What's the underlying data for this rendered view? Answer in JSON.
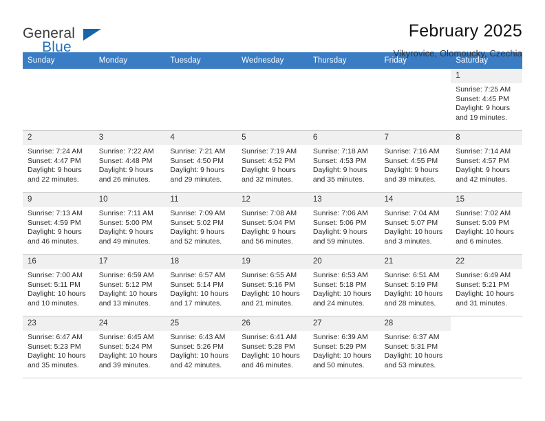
{
  "brand": {
    "name_part1": "General",
    "name_part2": "Blue",
    "triangle_icon": "brand-triangle-icon"
  },
  "header": {
    "title": "February 2025",
    "location": "Vikyrovice, Olomoucky, Czechia"
  },
  "colors": {
    "header_row_bg": "#3B7DC4",
    "header_row_text": "#FFFFFF",
    "brand_blue": "#2071B8",
    "cell_shade": "#F0F0F0",
    "empty_cell": "#F4F4F4",
    "grid_line": "#C9C9C9"
  },
  "weekdays": [
    "Sunday",
    "Monday",
    "Tuesday",
    "Wednesday",
    "Thursday",
    "Friday",
    "Saturday"
  ],
  "weeks": [
    [
      {
        "day": "",
        "empty": true
      },
      {
        "day": "",
        "empty": true
      },
      {
        "day": "",
        "empty": true
      },
      {
        "day": "",
        "empty": true
      },
      {
        "day": "",
        "empty": true
      },
      {
        "day": "",
        "empty": true
      },
      {
        "day": "1",
        "sunrise": "Sunrise: 7:25 AM",
        "sunset": "Sunset: 4:45 PM",
        "daylight1": "Daylight: 9 hours",
        "daylight2": "and 19 minutes."
      }
    ],
    [
      {
        "day": "2",
        "sunrise": "Sunrise: 7:24 AM",
        "sunset": "Sunset: 4:47 PM",
        "daylight1": "Daylight: 9 hours",
        "daylight2": "and 22 minutes."
      },
      {
        "day": "3",
        "sunrise": "Sunrise: 7:22 AM",
        "sunset": "Sunset: 4:48 PM",
        "daylight1": "Daylight: 9 hours",
        "daylight2": "and 26 minutes."
      },
      {
        "day": "4",
        "sunrise": "Sunrise: 7:21 AM",
        "sunset": "Sunset: 4:50 PM",
        "daylight1": "Daylight: 9 hours",
        "daylight2": "and 29 minutes."
      },
      {
        "day": "5",
        "sunrise": "Sunrise: 7:19 AM",
        "sunset": "Sunset: 4:52 PM",
        "daylight1": "Daylight: 9 hours",
        "daylight2": "and 32 minutes."
      },
      {
        "day": "6",
        "sunrise": "Sunrise: 7:18 AM",
        "sunset": "Sunset: 4:53 PM",
        "daylight1": "Daylight: 9 hours",
        "daylight2": "and 35 minutes."
      },
      {
        "day": "7",
        "sunrise": "Sunrise: 7:16 AM",
        "sunset": "Sunset: 4:55 PM",
        "daylight1": "Daylight: 9 hours",
        "daylight2": "and 39 minutes."
      },
      {
        "day": "8",
        "sunrise": "Sunrise: 7:14 AM",
        "sunset": "Sunset: 4:57 PM",
        "daylight1": "Daylight: 9 hours",
        "daylight2": "and 42 minutes."
      }
    ],
    [
      {
        "day": "9",
        "sunrise": "Sunrise: 7:13 AM",
        "sunset": "Sunset: 4:59 PM",
        "daylight1": "Daylight: 9 hours",
        "daylight2": "and 46 minutes."
      },
      {
        "day": "10",
        "sunrise": "Sunrise: 7:11 AM",
        "sunset": "Sunset: 5:00 PM",
        "daylight1": "Daylight: 9 hours",
        "daylight2": "and 49 minutes."
      },
      {
        "day": "11",
        "sunrise": "Sunrise: 7:09 AM",
        "sunset": "Sunset: 5:02 PM",
        "daylight1": "Daylight: 9 hours",
        "daylight2": "and 52 minutes."
      },
      {
        "day": "12",
        "sunrise": "Sunrise: 7:08 AM",
        "sunset": "Sunset: 5:04 PM",
        "daylight1": "Daylight: 9 hours",
        "daylight2": "and 56 minutes."
      },
      {
        "day": "13",
        "sunrise": "Sunrise: 7:06 AM",
        "sunset": "Sunset: 5:06 PM",
        "daylight1": "Daylight: 9 hours",
        "daylight2": "and 59 minutes."
      },
      {
        "day": "14",
        "sunrise": "Sunrise: 7:04 AM",
        "sunset": "Sunset: 5:07 PM",
        "daylight1": "Daylight: 10 hours",
        "daylight2": "and 3 minutes."
      },
      {
        "day": "15",
        "sunrise": "Sunrise: 7:02 AM",
        "sunset": "Sunset: 5:09 PM",
        "daylight1": "Daylight: 10 hours",
        "daylight2": "and 6 minutes."
      }
    ],
    [
      {
        "day": "16",
        "sunrise": "Sunrise: 7:00 AM",
        "sunset": "Sunset: 5:11 PM",
        "daylight1": "Daylight: 10 hours",
        "daylight2": "and 10 minutes."
      },
      {
        "day": "17",
        "sunrise": "Sunrise: 6:59 AM",
        "sunset": "Sunset: 5:12 PM",
        "daylight1": "Daylight: 10 hours",
        "daylight2": "and 13 minutes."
      },
      {
        "day": "18",
        "sunrise": "Sunrise: 6:57 AM",
        "sunset": "Sunset: 5:14 PM",
        "daylight1": "Daylight: 10 hours",
        "daylight2": "and 17 minutes."
      },
      {
        "day": "19",
        "sunrise": "Sunrise: 6:55 AM",
        "sunset": "Sunset: 5:16 PM",
        "daylight1": "Daylight: 10 hours",
        "daylight2": "and 21 minutes."
      },
      {
        "day": "20",
        "sunrise": "Sunrise: 6:53 AM",
        "sunset": "Sunset: 5:18 PM",
        "daylight1": "Daylight: 10 hours",
        "daylight2": "and 24 minutes."
      },
      {
        "day": "21",
        "sunrise": "Sunrise: 6:51 AM",
        "sunset": "Sunset: 5:19 PM",
        "daylight1": "Daylight: 10 hours",
        "daylight2": "and 28 minutes."
      },
      {
        "day": "22",
        "sunrise": "Sunrise: 6:49 AM",
        "sunset": "Sunset: 5:21 PM",
        "daylight1": "Daylight: 10 hours",
        "daylight2": "and 31 minutes."
      }
    ],
    [
      {
        "day": "23",
        "sunrise": "Sunrise: 6:47 AM",
        "sunset": "Sunset: 5:23 PM",
        "daylight1": "Daylight: 10 hours",
        "daylight2": "and 35 minutes."
      },
      {
        "day": "24",
        "sunrise": "Sunrise: 6:45 AM",
        "sunset": "Sunset: 5:24 PM",
        "daylight1": "Daylight: 10 hours",
        "daylight2": "and 39 minutes."
      },
      {
        "day": "25",
        "sunrise": "Sunrise: 6:43 AM",
        "sunset": "Sunset: 5:26 PM",
        "daylight1": "Daylight: 10 hours",
        "daylight2": "and 42 minutes."
      },
      {
        "day": "26",
        "sunrise": "Sunrise: 6:41 AM",
        "sunset": "Sunset: 5:28 PM",
        "daylight1": "Daylight: 10 hours",
        "daylight2": "and 46 minutes."
      },
      {
        "day": "27",
        "sunrise": "Sunrise: 6:39 AM",
        "sunset": "Sunset: 5:29 PM",
        "daylight1": "Daylight: 10 hours",
        "daylight2": "and 50 minutes."
      },
      {
        "day": "28",
        "sunrise": "Sunrise: 6:37 AM",
        "sunset": "Sunset: 5:31 PM",
        "daylight1": "Daylight: 10 hours",
        "daylight2": "and 53 minutes."
      },
      {
        "day": "",
        "empty": true
      }
    ]
  ]
}
